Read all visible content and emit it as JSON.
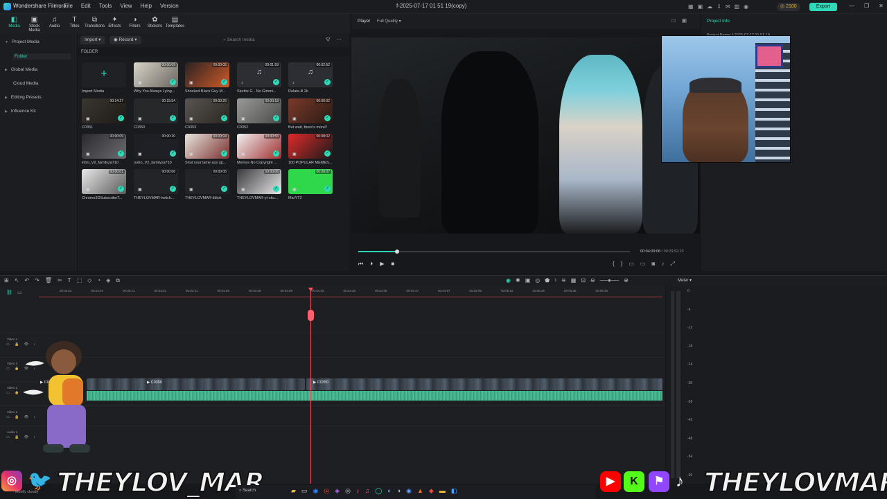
{
  "app": {
    "name": "Wondershare Filmora",
    "doc_title": "f-2025-07-17 01 51 19(copy)",
    "credits": "2100",
    "export_label": "Export"
  },
  "menu": [
    "File",
    "Edit",
    "Tools",
    "View",
    "Help",
    "Version"
  ],
  "top_tabs": [
    {
      "label": "Media",
      "icon": "◧"
    },
    {
      "label": "Stock Media",
      "icon": "▣"
    },
    {
      "label": "Audio",
      "icon": "♫"
    },
    {
      "label": "Titles",
      "icon": "T"
    },
    {
      "label": "Transitions",
      "icon": "⧉"
    },
    {
      "label": "Effects",
      "icon": "✦"
    },
    {
      "label": "Filters",
      "icon": "◑"
    },
    {
      "label": "Stickers",
      "icon": "✿"
    },
    {
      "label": "Templates",
      "icon": "▤"
    }
  ],
  "sidebar": [
    {
      "label": "Project Media"
    },
    {
      "label": "Folder"
    },
    {
      "label": "Global Media"
    },
    {
      "label": "Cloud Media"
    },
    {
      "label": "Editing Presets"
    },
    {
      "label": "Influence Kit"
    }
  ],
  "media_toolbar": {
    "import": "Import",
    "record": "Record",
    "search_placeholder": "Search media"
  },
  "folder_label": "FOLDER",
  "media": [
    {
      "name": "Import Media",
      "duration": "",
      "type": "import"
    },
    {
      "name": "Why You Always Lying...",
      "duration": "00:00:09",
      "type": "video"
    },
    {
      "name": "Shocked Black Guy M...",
      "duration": "00:00:05",
      "type": "video"
    },
    {
      "name": "Skottie G - No Gimmi...",
      "duration": "00:01:59",
      "type": "audio"
    },
    {
      "name": "Relate-lil 2k",
      "duration": "00:02:52",
      "type": "audio"
    },
    {
      "name": "C0351",
      "duration": "00:14:27",
      "type": "video"
    },
    {
      "name": "C0350",
      "duration": "00:15:54",
      "type": "video"
    },
    {
      "name": "C0353",
      "duration": "00:00:25",
      "type": "video"
    },
    {
      "name": "C0352",
      "duration": "00:00:18",
      "type": "video"
    },
    {
      "name": "But wait, there's more!!",
      "duration": "00:00:02",
      "type": "video"
    },
    {
      "name": "intro_V2_familyza710",
      "duration": "00:00:09",
      "type": "video"
    },
    {
      "name": "outro_V2_familyza710",
      "duration": "00:00:20",
      "type": "video"
    },
    {
      "name": "Shut your lame ass up...",
      "duration": "00:00:04",
      "type": "video"
    },
    {
      "name": "Memes No Copyright ...",
      "duration": "00:00:55",
      "type": "video"
    },
    {
      "name": "100 POPULAR MEMES...",
      "duration": "00:08:02",
      "type": "video"
    },
    {
      "name": "Chrome3DSubscribeT...",
      "duration": "00:00:01",
      "type": "video"
    },
    {
      "name": "THEYLOVMAR-twitch...",
      "duration": "00:00:06",
      "type": "video"
    },
    {
      "name": "THEYLOVMAR-tiktok",
      "duration": "00:00:05",
      "type": "video"
    },
    {
      "name": "THEYLOVMAR-yt-sku...",
      "duration": "00:00:06",
      "type": "video"
    },
    {
      "name": "MarYT2",
      "duration": "00:00:07",
      "type": "video"
    }
  ],
  "player": {
    "label": "Player",
    "quality": "Full Quality",
    "current": "00:04:09:08",
    "total": "/  00:29:52:23"
  },
  "right_panel": {
    "label": "Project Info",
    "meta": "Project Name:   f-2025-07-17 01 51 19"
  },
  "timeline": {
    "ruler": [
      "00:02:52",
      "00:03:01",
      "00:03:21",
      "00:03:31",
      "00:03:41",
      "00:03:50",
      "00:03:59",
      "00:04:09",
      "00:04:19",
      "00:04:28",
      "00:04:38",
      "00:04:47",
      "00:04:57",
      "00:05:06",
      "00:05:16",
      "00:05:26",
      "00:05:35",
      "00:05:45"
    ],
    "tracks": [
      "Video 4",
      "Video 3",
      "Video 2",
      "Video 1",
      "Audio 1"
    ],
    "clips": [
      "C0350",
      "C0350",
      "C0350"
    ],
    "meter_label": "Meter",
    "meter_scale": [
      "0",
      "-6",
      "-12",
      "-18",
      "-24",
      "-30",
      "-36",
      "-42",
      "-48",
      "-54",
      "-60"
    ]
  },
  "overlay": {
    "left_text": "THEYLOV_MAR",
    "right_text": "THEYLOVMAR"
  },
  "taskbar": {
    "weather": "Mostly cloudy",
    "search": "Search"
  },
  "colors": {
    "accent": "#2fd8b6",
    "playhead": "#ff4d5e",
    "audio": "#3fbf93"
  }
}
